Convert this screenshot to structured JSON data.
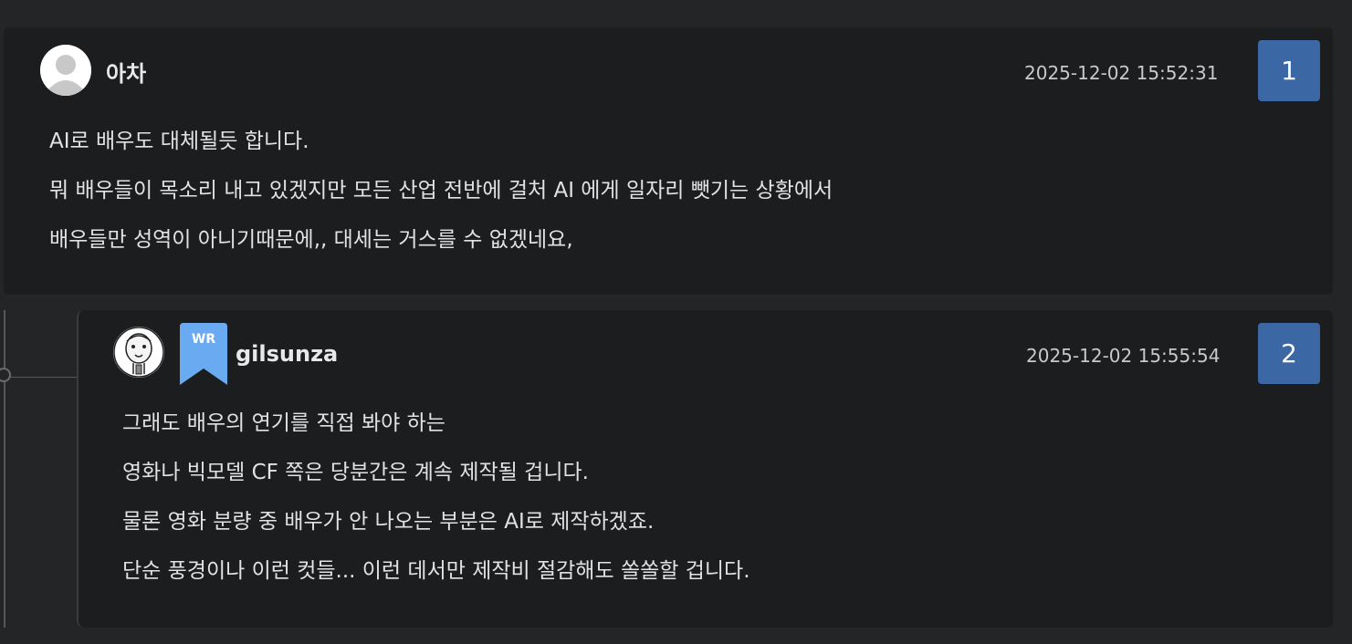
{
  "comments": [
    {
      "author": "아차",
      "date": "2025-12-02 15:52:31",
      "number": "1",
      "lines": [
        "AI로 배우도 대체될듯 합니다.",
        "뭐 배우들이 목소리  내고 있겠지만 모든 산업 전반에 걸처 AI 에게 일자리 뺏기는 상황에서",
        "배우들만 성역이 아니기때문에,, 대세는 거스를 수 없겠네요,"
      ]
    },
    {
      "author": "gilsunza",
      "badge": "WR",
      "date": "2025-12-02 15:55:54",
      "number": "2",
      "lines": [
        "그래도 배우의 연기를 직접 봐야 하는",
        "영화나 빅모델 CF 쪽은 당분간은 계속 제작될 겁니다.",
        "물론 영화 분량 중 배우가 안 나오는 부분은 AI로 제작하겠죠.",
        "단순 풍경이나 이런 컷들... 이런 데서만 제작비 절감해도 쏠쏠할 겁니다."
      ]
    }
  ],
  "colors": {
    "background": "#242527",
    "card": "#1c1d1f",
    "number_badge": "#3b67a4",
    "wr_badge": "#6aaaf0"
  }
}
